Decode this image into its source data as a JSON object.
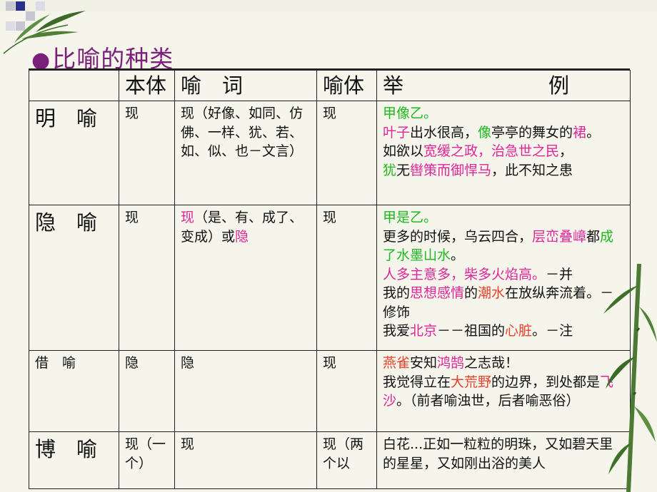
{
  "title": "比喻的种类",
  "headers": [
    "",
    "本体",
    "喻　词",
    "喻体",
    "举　　　　　　　例"
  ],
  "rows": [
    {
      "type": "明　喻",
      "benti": "现",
      "yuci": "现（好像、如同、仿佛、一样、犹、若、如、似、也－文言）",
      "yuti": "现",
      "example": [
        [
          [
            "甲像乙。",
            "g"
          ]
        ],
        [
          [
            "叶子",
            "m"
          ],
          [
            "出水很高，",
            ""
          ],
          [
            "像",
            "g"
          ],
          [
            "亭亭的舞女的",
            ""
          ],
          [
            "裙",
            "m"
          ],
          [
            "。",
            ""
          ]
        ],
        [
          [
            "如欲以",
            ""
          ],
          [
            "宽缓之政，治急世之民",
            "m"
          ],
          [
            "，",
            ""
          ]
        ],
        [
          [
            "犹",
            "g"
          ],
          [
            "无",
            ""
          ],
          [
            "辔策而御悍马",
            "m"
          ],
          [
            "，此不知之患",
            ""
          ]
        ]
      ]
    },
    {
      "type": "隐　喻",
      "benti": "现",
      "yuci": [
        [
          "现",
          "m"
        ],
        [
          "（是、有、成了、变成）或",
          ""
        ],
        [
          "隐",
          "m"
        ]
      ],
      "yuti": "现",
      "example": [
        [
          [
            "甲是乙。",
            "g"
          ]
        ],
        [
          [
            "更多的时候，乌云四合，",
            ""
          ],
          [
            "层峦叠嶂",
            "m"
          ],
          [
            "都",
            ""
          ],
          [
            "成了水墨山水",
            "g"
          ],
          [
            "。",
            ""
          ]
        ],
        [
          [
            "人多主意多，柴多火焰高。",
            "m"
          ],
          [
            "－并",
            ""
          ]
        ],
        [
          [
            "我的",
            ""
          ],
          [
            "思想感情",
            "m"
          ],
          [
            "的",
            ""
          ],
          [
            "潮水",
            "r"
          ],
          [
            "在放纵奔流着。－修饰",
            ""
          ]
        ],
        [
          [
            "我爱",
            ""
          ],
          [
            "北京",
            "m"
          ],
          [
            "－－祖国的",
            ""
          ],
          [
            "心脏",
            "r"
          ],
          [
            "。－注",
            ""
          ]
        ]
      ]
    },
    {
      "type": "借　喻",
      "benti": "隐",
      "yuci": "隐",
      "yuti": "现",
      "example": [
        [
          [
            "燕雀",
            "r"
          ],
          [
            "安知",
            ""
          ],
          [
            "鸿鹄",
            "m"
          ],
          [
            "之志哉！",
            ""
          ]
        ],
        [
          [
            "我觉得立在",
            ""
          ],
          [
            "大荒野",
            "r"
          ],
          [
            "的边界，到处都是",
            ""
          ],
          [
            "飞沙",
            "m"
          ],
          [
            "。（前者喻浊世，后者喻恶俗）",
            ""
          ]
        ]
      ]
    },
    {
      "type": "博　喻",
      "benti": "现（一个）",
      "yuci": "现",
      "yuti": "现（两个以",
      "example": [
        [
          [
            "白花...正如一粒粒的明珠，又如碧天里的星星，又如刚出浴的美人",
            ""
          ]
        ]
      ]
    }
  ],
  "colors": {
    "magenta": "#e0249a",
    "green": "#1fb81f",
    "red": "#e8402a",
    "title": "#7a1f7a",
    "background": "#f5f5eb"
  }
}
